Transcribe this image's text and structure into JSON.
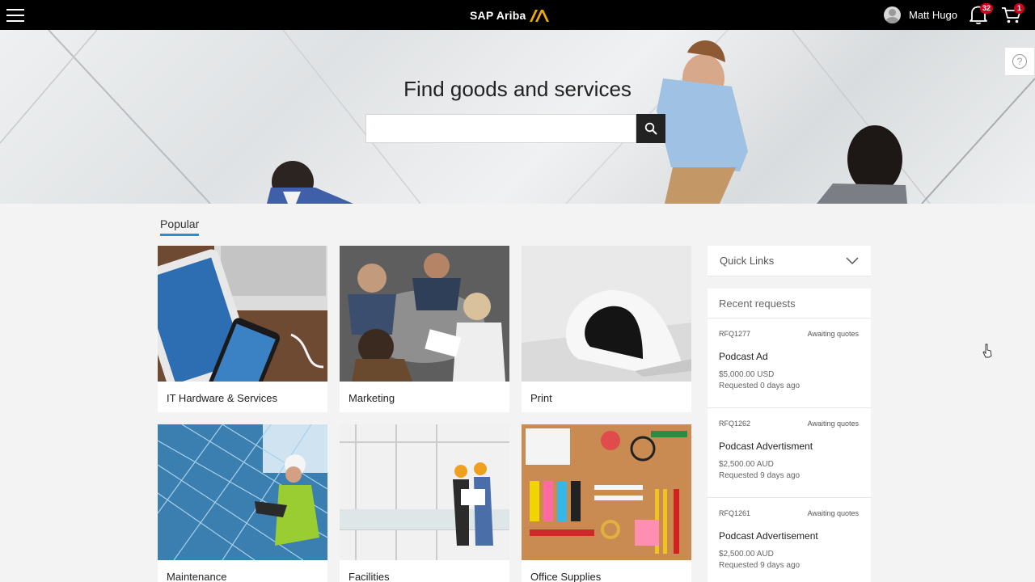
{
  "topbar": {
    "brand": "SAP Ariba",
    "user_name": "Matt Hugo",
    "notifications_count": "32",
    "cart_count": "1"
  },
  "hero": {
    "title": "Find goods and services",
    "search_value": "",
    "search_placeholder": ""
  },
  "popular": {
    "tab_label": "Popular",
    "categories": [
      {
        "label": "IT Hardware & Services"
      },
      {
        "label": "Marketing"
      },
      {
        "label": "Print"
      },
      {
        "label": "Maintenance"
      },
      {
        "label": "Facilities"
      },
      {
        "label": "Office Supplies"
      }
    ]
  },
  "sidepanel": {
    "quick_links_label": "Quick Links",
    "recent_title": "Recent requests",
    "requests": [
      {
        "id": "RFQ1277",
        "status": "Awaiting quotes",
        "name": "Podcast Ad",
        "amount": "$5,000.00 USD",
        "date": "Requested 0 days ago"
      },
      {
        "id": "RFQ1262",
        "status": "Awaiting quotes",
        "name": "Podcast Advertisment",
        "amount": "$2,500.00 AUD",
        "date": "Requested 9 days ago"
      },
      {
        "id": "RFQ1261",
        "status": "Awaiting quotes",
        "name": "Podcast Advertisement",
        "amount": "$2,500.00 AUD",
        "date": "Requested 9 days ago"
      }
    ]
  },
  "icons": {
    "menu": "hamburger-menu-icon",
    "search": "search-icon",
    "bell": "bell-icon",
    "cart": "cart-icon",
    "help": "help-icon",
    "chevron": "chevron-down-icon"
  },
  "colors": {
    "topbar": "#000000",
    "accent": "#2d8ccb",
    "badge": "#d0021b",
    "brand_logo": "#f0ab00"
  }
}
